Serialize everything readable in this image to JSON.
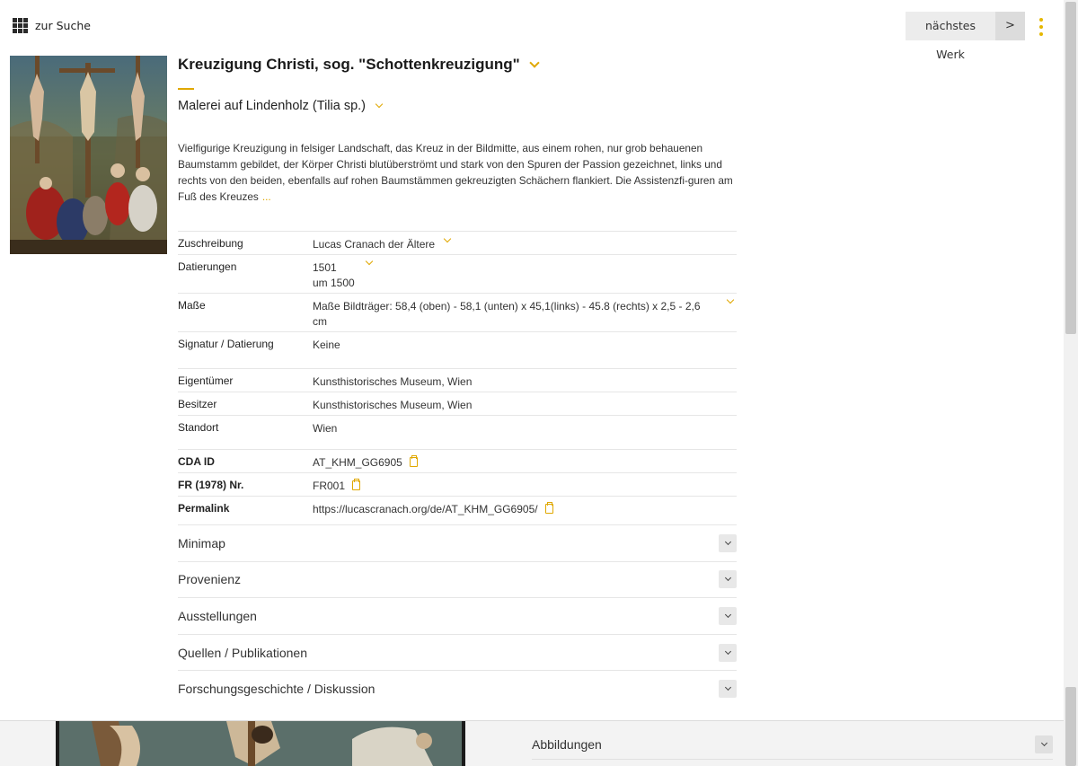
{
  "nav": {
    "back_label": "zur Suche",
    "next_label": "nächstes Werk",
    "next_arrow": ">"
  },
  "artwork": {
    "title": "Kreuzigung Christi, sog. \"Schottenkreuzigung\"",
    "medium": "Malerei auf Lindenholz (Tilia sp.)",
    "description": "Vielfigurige Kreuzigung in felsiger Landschaft, das Kreuz in der Bildmitte, aus einem rohen, nur grob behauenen Baumstamm gebildet, der Körper Christi blutüberströmt und stark von den Spuren der Passion gezeichnet, links und rechts von den beiden, ebenfalls auf rohen Baumstämmen gekreuzigten Schächern flankiert. Die Assistenzfi-guren am Fuß des Kreuzes",
    "more": "..."
  },
  "meta1": [
    {
      "label": "Zuschreibung",
      "value": "Lucas Cranach der Ältere"
    },
    {
      "label": "Datierungen",
      "value": "1501",
      "value2": "um 1500"
    },
    {
      "label": "Maße",
      "value": "Maße Bildträger: 58,4 (oben) - 58,1 (unten) x 45,1(links) - 45.8 (rechts) x 2,5 - 2,6 cm"
    },
    {
      "label": "Signatur / Datierung",
      "value": "Keine"
    }
  ],
  "meta2": [
    {
      "label": "Eigentümer",
      "value": "Kunsthistorisches Museum, Wien"
    },
    {
      "label": "Besitzer",
      "value": "Kunsthistorisches Museum, Wien"
    },
    {
      "label": "Standort",
      "value": "Wien"
    }
  ],
  "meta3": [
    {
      "label": "CDA ID",
      "value": "AT_KHM_GG6905"
    },
    {
      "label": "FR (1978) Nr.",
      "value": "FR001"
    },
    {
      "label": "Permalink",
      "value": "https://lucascranach.org/de/AT_KHM_GG6905/"
    }
  ],
  "sections": [
    {
      "label": "Minimap"
    },
    {
      "label": "Provenienz"
    },
    {
      "label": "Ausstellungen"
    },
    {
      "label": "Quellen / Publikationen"
    },
    {
      "label": "Forschungsgeschichte / Diskussion"
    }
  ],
  "lower": {
    "abbildungen_label": "Abbildungen"
  },
  "colors": {
    "accent": "#e0a800"
  }
}
